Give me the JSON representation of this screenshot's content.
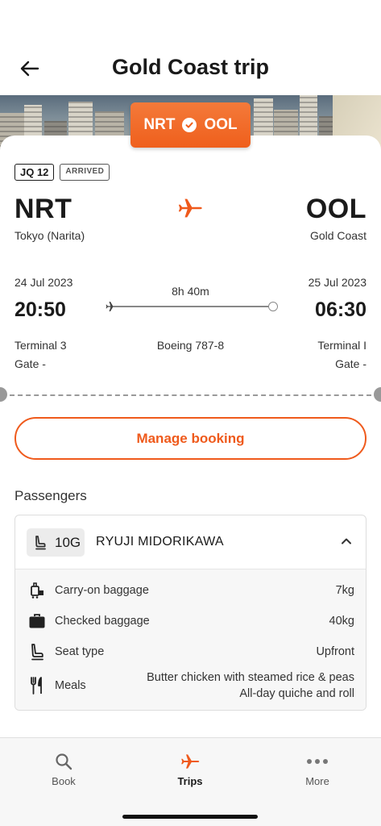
{
  "header": {
    "title": "Gold Coast trip",
    "back_icon": "arrow-left-icon"
  },
  "route_pill": {
    "from": "NRT",
    "to": "OOL",
    "status_icon": "check-circle-icon"
  },
  "flight": {
    "number": "JQ 12",
    "status": "ARRIVED",
    "origin": {
      "code": "NRT",
      "city": "Tokyo (Narita)",
      "date": "24 Jul 2023",
      "time": "20:50",
      "terminal": "Terminal 3",
      "gate": "Gate -"
    },
    "destination": {
      "code": "OOL",
      "city": "Gold Coast",
      "date": "25 Jul 2023",
      "time": "06:30",
      "terminal": "Terminal I",
      "gate": "Gate -"
    },
    "duration": "8h 40m",
    "aircraft": "Boeing 787-8"
  },
  "manage_booking": {
    "label": "Manage booking"
  },
  "passengers": {
    "title": "Passengers",
    "list": [
      {
        "seat": "10G",
        "name": "RYUJI MIDORIKAWA",
        "details": [
          {
            "icon": "carry-on-bag-icon",
            "label": "Carry-on baggage",
            "value": "7kg"
          },
          {
            "icon": "suitcase-icon",
            "label": "Checked baggage",
            "value": "40kg"
          },
          {
            "icon": "seat-icon",
            "label": "Seat type",
            "value": "Upfront"
          },
          {
            "icon": "cutlery-icon",
            "label": "Meals",
            "values": [
              "Butter chicken with steamed rice & peas",
              "All-day quiche and roll"
            ]
          }
        ]
      }
    ]
  },
  "nav": {
    "items": [
      {
        "label": "Book",
        "icon": "search-icon"
      },
      {
        "label": "Trips",
        "icon": "plane-icon",
        "active": true
      },
      {
        "label": "More",
        "icon": "dots-icon"
      }
    ]
  },
  "colors": {
    "accent": "#EF5A1C",
    "text": "#1A1A1A"
  }
}
